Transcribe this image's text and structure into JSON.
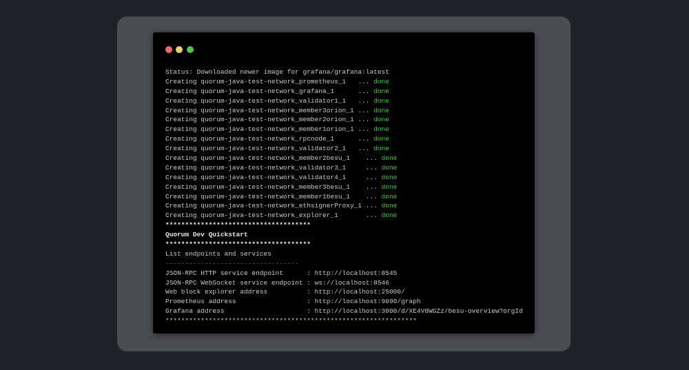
{
  "window_controls": {
    "close_color": "#ec6a6a",
    "minimize_color": "#efd25c",
    "maximize_color": "#4fc54a"
  },
  "terminal": {
    "status_line": "Status: Downloaded newer image for grafana/grafana:latest",
    "creating": [
      {
        "name": "Creating quorum-java-test-network_prometheus_1   ... ",
        "status": "done"
      },
      {
        "name": "Creating quorum-java-test-network_grafana_1      ... ",
        "status": "done"
      },
      {
        "name": "Creating quorum-java-test-network_validator1_1   ... ",
        "status": "done"
      },
      {
        "name": "Creating quorum-java-test-network_member3orion_1 ... ",
        "status": "done"
      },
      {
        "name": "Creating quorum-java-test-network_member2orion_1 ... ",
        "status": "done"
      },
      {
        "name": "Creating quorum-java-test-network_member1orion_1 ... ",
        "status": "done"
      },
      {
        "name": "Creating quorum-java-test-network_rpcnode_1      ... ",
        "status": "done"
      },
      {
        "name": "Creating quorum-java-test-network_validator2_1   ... ",
        "status": "done"
      },
      {
        "name": "Creating quorum-java-test-network_member2besu_1    ... ",
        "status": "done"
      },
      {
        "name": "Creating quorum-java-test-network_validator3_1     ... ",
        "status": "done"
      },
      {
        "name": "Creating quorum-java-test-network_validator4_1     ... ",
        "status": "done"
      },
      {
        "name": "Creating quorum-java-test-network_member3besu_1    ... ",
        "status": "done"
      },
      {
        "name": "Creating quorum-java-test-network_member1besu_1    ... ",
        "status": "done"
      },
      {
        "name": "Creating quorum-java-test-network_ethsignerProxy_1 ... ",
        "status": "done"
      },
      {
        "name": "Creating quorum-java-test-network_explorer_1       ... ",
        "status": "done"
      }
    ],
    "stars_short": "*************************************",
    "heading": "Quorum Dev Quickstart",
    "list_title": "List endpoints and services",
    "dashes": "----------------------------------",
    "endpoints": [
      {
        "label": "JSON-RPC HTTP service endpoint      : ",
        "value": "http://localhost:8545"
      },
      {
        "label": "JSON-RPC WebSocket service endpoint : ",
        "value": "ws://localhost:8546"
      },
      {
        "label": "Web block explorer address          : ",
        "value": "http://localhost:25000/"
      },
      {
        "label": "Prometheus address                  : ",
        "value": "http://localhost:9090/graph"
      },
      {
        "label": "Grafana address                     : ",
        "value": "http://localhost:3000/d/XE4V0WGZz/besu-overview?orgId"
      }
    ],
    "stars_long": "****************************************************************"
  }
}
